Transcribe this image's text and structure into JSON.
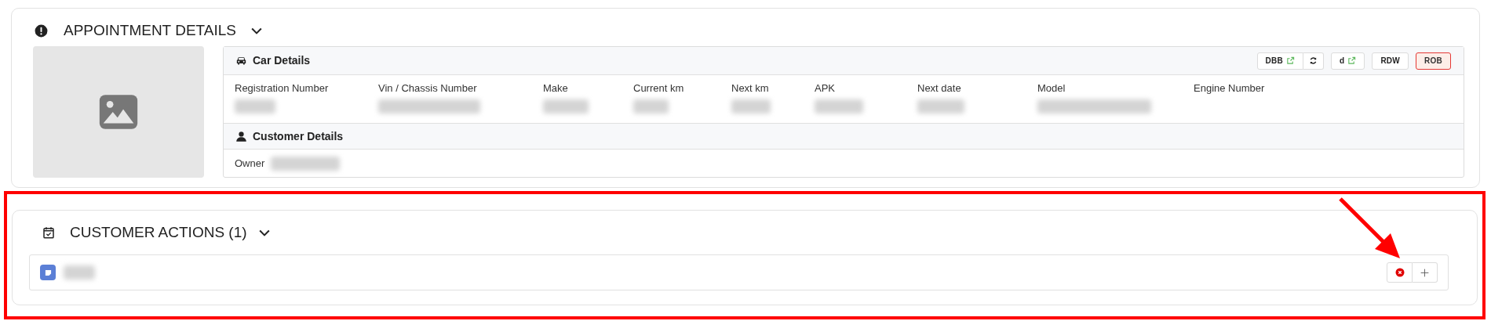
{
  "appointment": {
    "title": "APPOINTMENT DETAILS",
    "expanded": true,
    "car_details": {
      "title": "Car Details",
      "buttons": [
        {
          "kind": "split",
          "label": "DBB",
          "external": true,
          "selected": false
        },
        {
          "kind": "plain",
          "label": "d",
          "external": true,
          "selected": false
        },
        {
          "kind": "plain",
          "label": "RDW",
          "external": false,
          "selected": false
        },
        {
          "kind": "plain",
          "label": "ROB",
          "external": false,
          "selected": true
        }
      ],
      "fields": [
        {
          "label": "Registration Number",
          "redacted": true
        },
        {
          "label": "Vin / Chassis Number",
          "redacted": true
        },
        {
          "label": "Make",
          "redacted": true
        },
        {
          "label": "Current km",
          "redacted": true
        },
        {
          "label": "Next km",
          "redacted": true
        },
        {
          "label": "APK",
          "redacted": true
        },
        {
          "label": "Next date",
          "redacted": true
        },
        {
          "label": "Model",
          "redacted": true
        },
        {
          "label": "Engine Number",
          "redacted": false
        }
      ]
    },
    "customer_details": {
      "title": "Customer Details",
      "fields": [
        {
          "label": "Owner",
          "redacted": true
        }
      ]
    }
  },
  "customer_actions": {
    "title": "CUSTOMER ACTIONS (1)",
    "expanded": true,
    "items": [
      {
        "color": "#5b7fd6",
        "redacted": true
      }
    ]
  }
}
